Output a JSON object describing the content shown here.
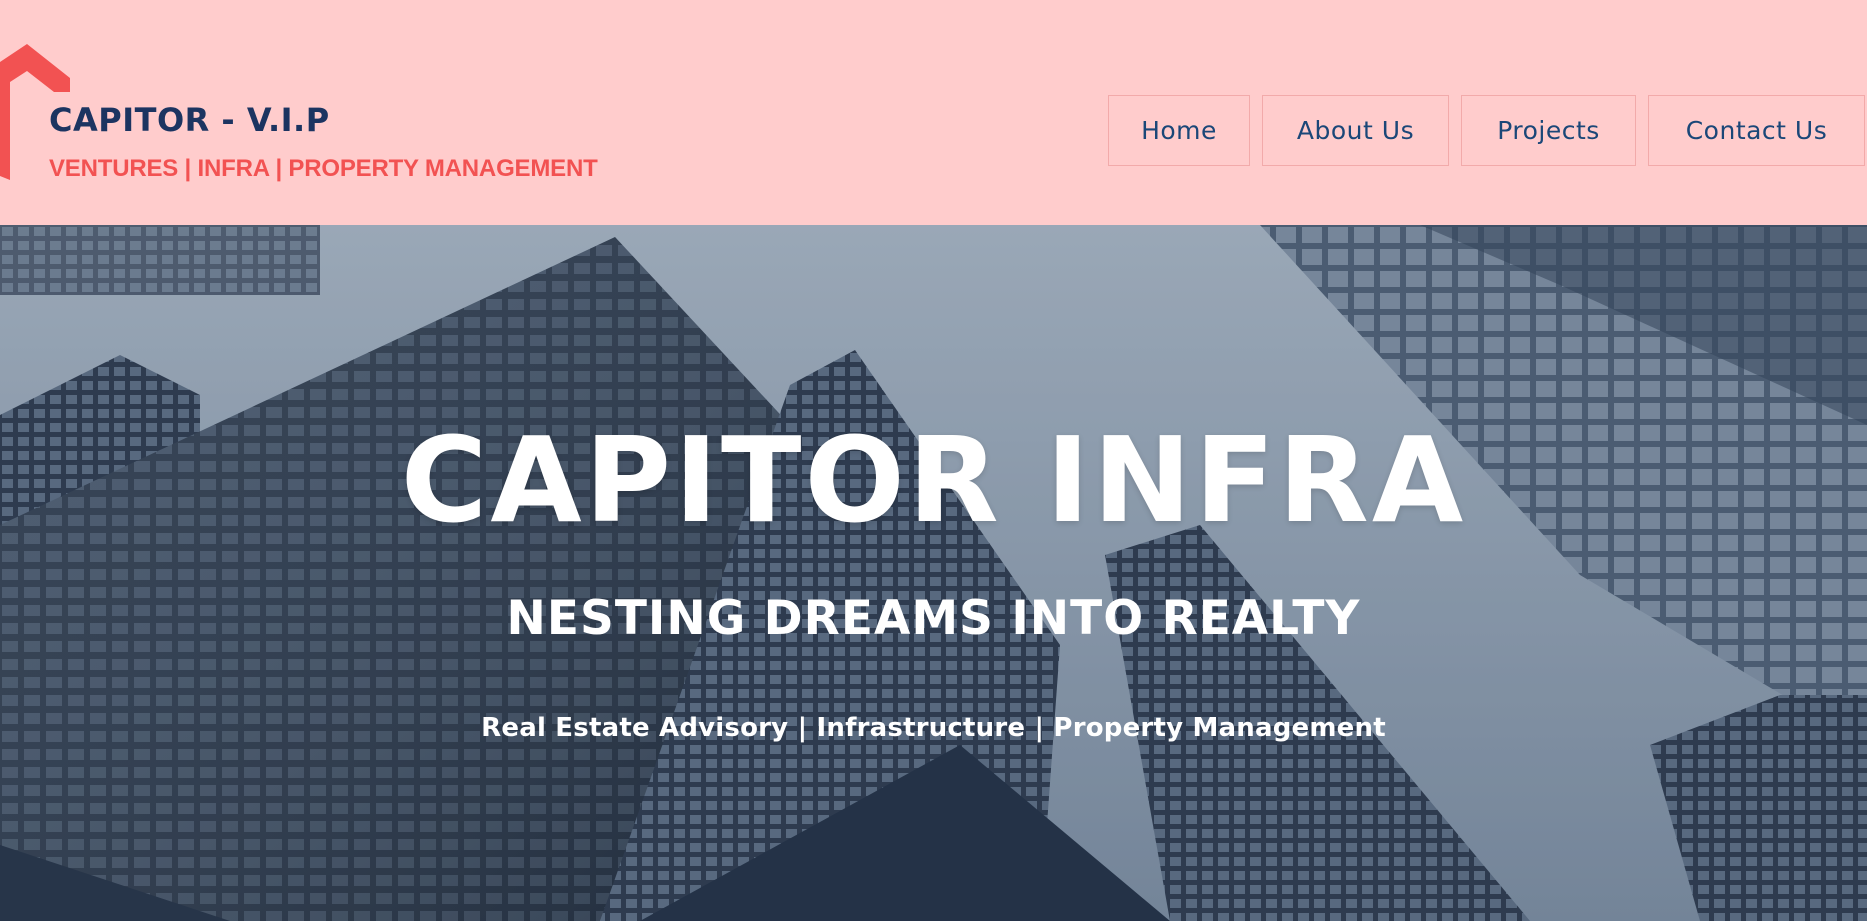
{
  "header": {
    "brand": {
      "title": "CAPITOR - V.I.P",
      "tagline": "VENTURES | INFRA | PROPERTY MANAGEMENT",
      "logo_icon": "house-roof-icon"
    },
    "nav": [
      {
        "label": "Home"
      },
      {
        "label": "About Us"
      },
      {
        "label": "Projects"
      },
      {
        "label": "Contact Us"
      }
    ]
  },
  "hero": {
    "title": "CAPITOR INFRA",
    "subtitle": "NESTING DREAMS INTO REALTY",
    "services": "Real Estate Advisory | Infrastructure | Property Management",
    "background": "skyscrapers-background-image"
  },
  "colors": {
    "header_bg": "#FFCCCC",
    "brand_navy": "#1C3461",
    "brand_red": "#F25252",
    "nav_text": "#1B4778",
    "hero_text": "#FFFFFF"
  }
}
